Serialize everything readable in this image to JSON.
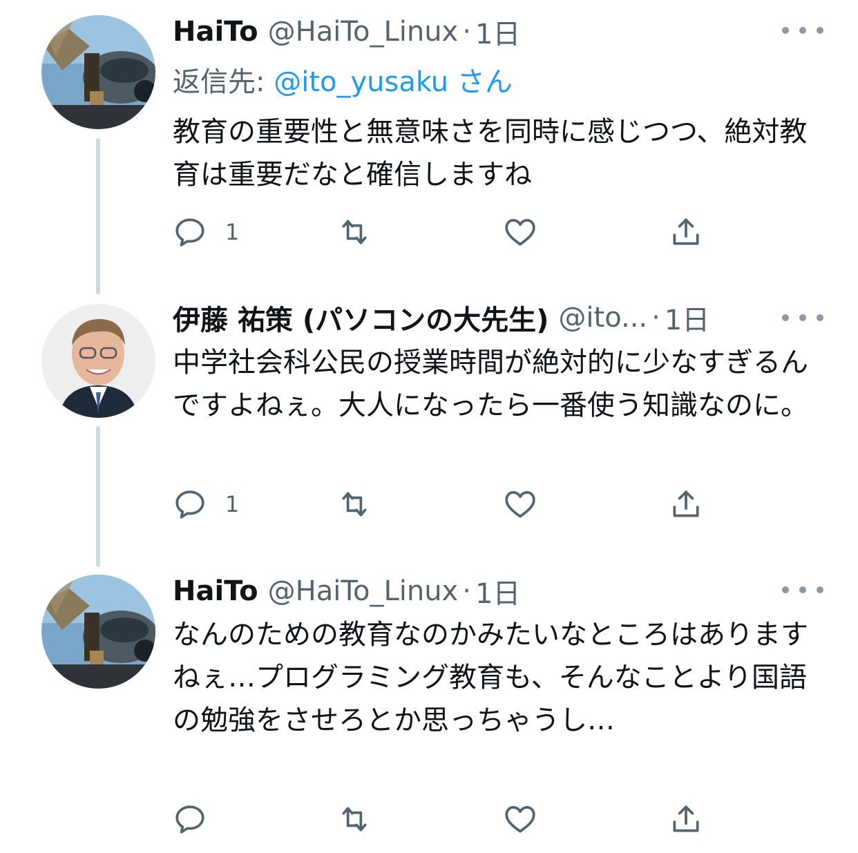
{
  "tweets": [
    {
      "name": "HaiTo",
      "handle": "@HaiTo_Linux",
      "separator": "·",
      "time": "1日",
      "reply_prefix": "返信先: ",
      "reply_handle": "@ito_yusaku",
      "reply_suffix": " さん",
      "text": "教育の重要性と無意味さを同時に感じつつ、絶対教育は重要だなと確信しますね",
      "reply_count": "1",
      "retweet_count": "",
      "like_count": ""
    },
    {
      "name": "伊藤 祐策 (パソコンの大先生)",
      "handle": "@ito...",
      "separator": "·",
      "time": "1日",
      "text": "中学社会科公民の授業時間が絶対的に少なすぎるんですよねぇ。大人になったら一番使う知識なのに。",
      "reply_count": "1",
      "retweet_count": "",
      "like_count": ""
    },
    {
      "name": "HaiTo",
      "handle": "@HaiTo_Linux",
      "separator": "·",
      "time": "1日",
      "text": "なんのための教育なのかみたいなところはありますねぇ…プログラミング教育も、そんなことより国語の勉強をさせろとか思っちゃうし…",
      "reply_count": "",
      "retweet_count": "",
      "like_count": ""
    }
  ],
  "icons": {
    "reply": "speech-bubble-icon",
    "retweet": "retweet-arrows-icon",
    "like": "heart-icon",
    "share": "share-upload-icon",
    "more": "more-dots-icon"
  },
  "colors": {
    "text": "#0f1419",
    "secondary": "#536471",
    "link": "#1d9bf0",
    "thread_line": "#cfd9de"
  }
}
